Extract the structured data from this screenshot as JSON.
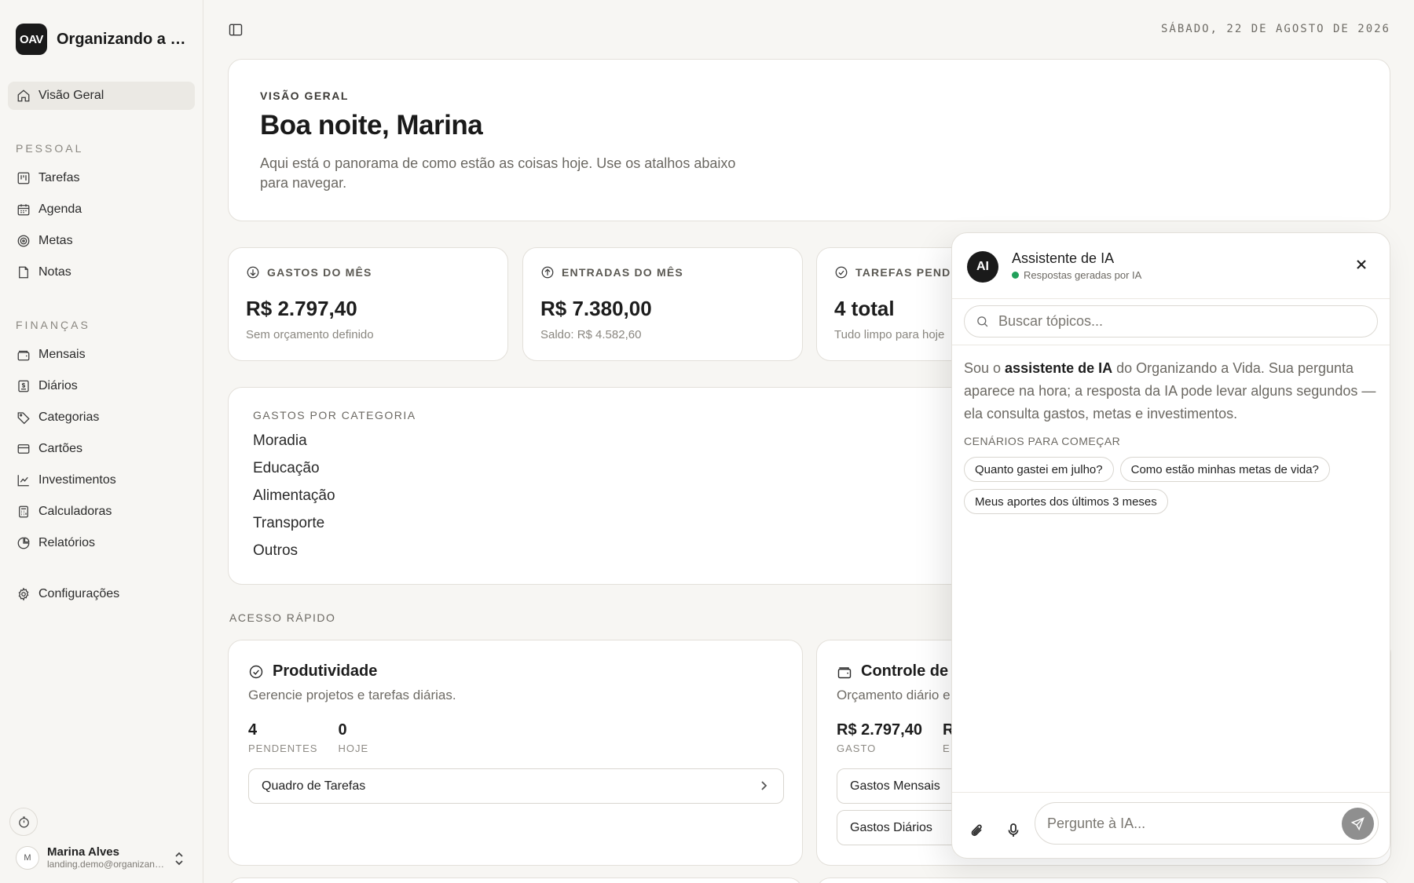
{
  "brand": {
    "logo": "OAV",
    "name": "Organizando a Vida"
  },
  "date": "SÁBADO, 22 DE AGOSTO DE 2026",
  "nav": {
    "overview": {
      "label": "Visão Geral",
      "icon": "home-icon"
    },
    "personal_section": "PESSOAL",
    "personal": [
      {
        "label": "Tarefas",
        "icon": "kanban-icon"
      },
      {
        "label": "Agenda",
        "icon": "calendar-icon"
      },
      {
        "label": "Metas",
        "icon": "target-icon"
      },
      {
        "label": "Notas",
        "icon": "note-icon"
      }
    ],
    "finance_section": "FINANÇAS",
    "finance": [
      {
        "label": "Mensais",
        "icon": "wallet-icon"
      },
      {
        "label": "Diários",
        "icon": "receipt-icon"
      },
      {
        "label": "Categorias",
        "icon": "tag-icon"
      },
      {
        "label": "Cartões",
        "icon": "credit-card-icon"
      },
      {
        "label": "Investimentos",
        "icon": "line-chart-icon"
      },
      {
        "label": "Calculadoras",
        "icon": "calculator-icon"
      },
      {
        "label": "Relatórios",
        "icon": "pie-chart-icon"
      }
    ],
    "settings": {
      "label": "Configurações",
      "icon": "gear-icon"
    }
  },
  "user": {
    "initial": "M",
    "name": "Marina Alves",
    "email": "landing.demo@organizandoavida.com"
  },
  "hero": {
    "eyebrow": "VISÃO GERAL",
    "title": "Boa noite, Marina",
    "subtitle": "Aqui está o panorama de como estão as coisas hoje. Use os atalhos abaixo para navegar."
  },
  "stats": [
    {
      "label": "GASTOS DO MÊS",
      "value": "R$ 2.797,40",
      "sub": "Sem orçamento definido",
      "icon": "arrow-down-circle-icon"
    },
    {
      "label": "ENTRADAS DO MÊS",
      "value": "R$ 7.380,00",
      "sub": "Saldo: R$ 4.582,60",
      "icon": "arrow-up-circle-icon"
    },
    {
      "label": "TAREFAS PENDENTES",
      "value": "4 total",
      "sub": "Tudo limpo para hoje",
      "icon": "check-circle-icon"
    }
  ],
  "categories": {
    "title": "GASTOS POR CATEGORIA",
    "items": [
      "Moradia",
      "Educação",
      "Alimentação",
      "Transporte",
      "Outros"
    ]
  },
  "quick": {
    "label": "ACESSO RÁPIDO",
    "productivity": {
      "title": "Produtividade",
      "desc": "Gerencie projetos e tarefas diárias.",
      "stats": [
        {
          "n": "4",
          "l": "PENDENTES"
        },
        {
          "n": "0",
          "l": "HOJE"
        }
      ],
      "button": "Quadro de Tarefas"
    },
    "finance": {
      "title": "Controle de",
      "desc": "Orçamento diário e",
      "stats": [
        {
          "n": "R$ 2.797,40",
          "l": "GASTO"
        },
        {
          "n": "R",
          "l": "E"
        }
      ],
      "buttons": [
        "Gastos Mensais",
        "Gastos Diários"
      ]
    }
  },
  "ai": {
    "avatar": "AI",
    "title": "Assistente de IA",
    "status": "Respostas geradas por IA",
    "search_placeholder": "Buscar tópicos...",
    "intro_pre": "Sou o ",
    "intro_bold": "assistente de IA",
    "intro_post": " do Organizando a Vida. Sua pergunta aparece na hora; a resposta da IA pode levar alguns segundos — ela consulta gastos, metas e investimentos.",
    "scenarios_label": "CENÁRIOS PARA COMEÇAR",
    "chips": [
      "Quanto gastei em julho?",
      "Como estão minhas metas de vida?",
      "Meus aportes dos últimos 3 meses"
    ],
    "input_placeholder": "Pergunte à IA..."
  },
  "colors": {
    "status_dot": "#22a05b",
    "send_button": "#8f8f8f",
    "brand_dark": "#1a1a1a"
  }
}
